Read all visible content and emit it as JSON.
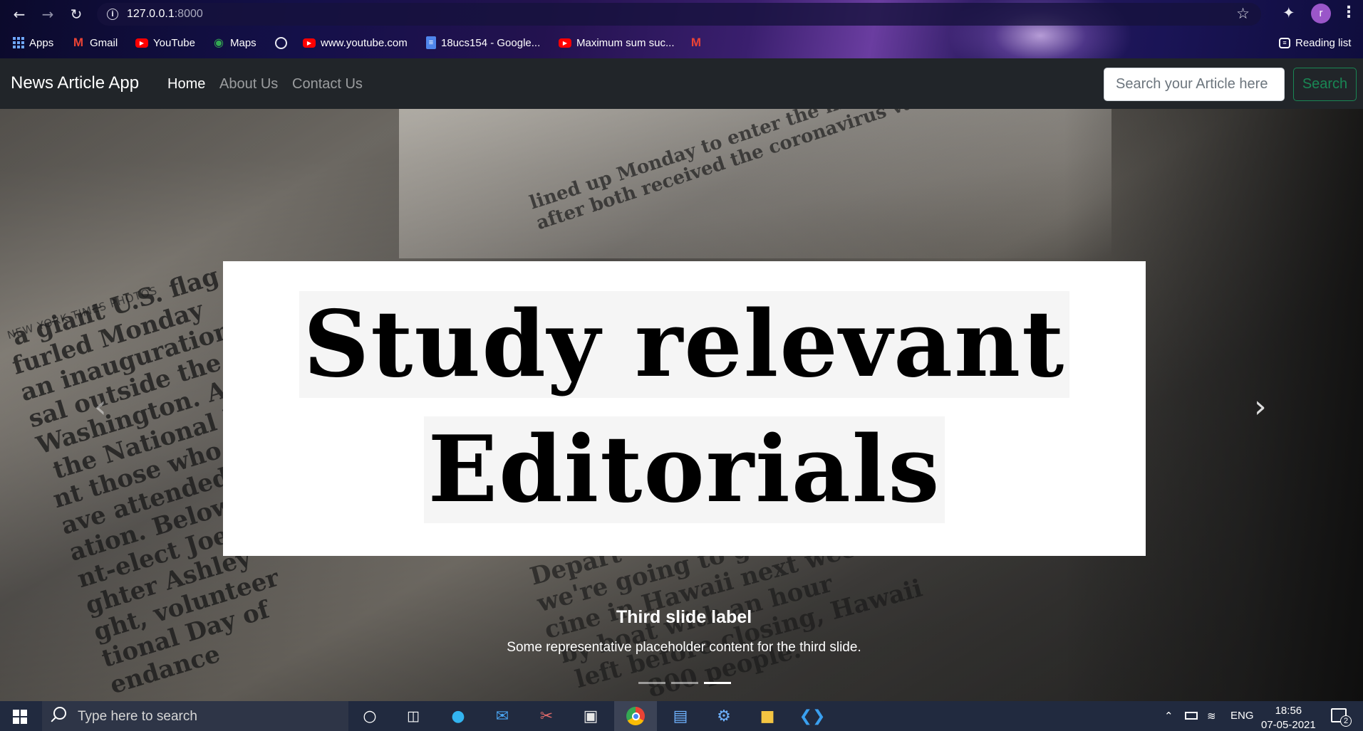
{
  "browser": {
    "url_host": "127.0.0.1",
    "url_port": ":8000",
    "bookmarks": [
      {
        "label": "Apps",
        "icon": "apps-grid-icon"
      },
      {
        "label": "Gmail",
        "icon": "gmail-icon"
      },
      {
        "label": "YouTube",
        "icon": "youtube-icon"
      },
      {
        "label": "Maps",
        "icon": "maps-pin-icon"
      },
      {
        "label": "",
        "icon": "globe-icon"
      },
      {
        "label": "www.youtube.com",
        "icon": "youtube-icon"
      },
      {
        "label": "18ucs154 - Google...",
        "icon": "google-docs-icon"
      },
      {
        "label": "Maximum sum suc...",
        "icon": "youtube-icon"
      },
      {
        "label": "",
        "icon": "gmail-icon"
      }
    ],
    "reading_list": "Reading list",
    "profile_initial": "r"
  },
  "navbar": {
    "brand": "News Article App",
    "links": [
      "Home",
      "About Us",
      "Contact Us"
    ],
    "search_placeholder": "Search your Article here",
    "search_button": "Search"
  },
  "carousel": {
    "headline_line1": "Study  relevant",
    "headline_line2": "Editorials",
    "caption_title": "Third slide label",
    "caption_text": "Some representative placeholder content for the third slide.",
    "slide_count": 3,
    "active_slide": 3
  },
  "taskbar": {
    "search_placeholder": "Type here to search",
    "language": "ENG",
    "time": "18:56",
    "date": "07-05-2021",
    "notification_count": "2"
  }
}
